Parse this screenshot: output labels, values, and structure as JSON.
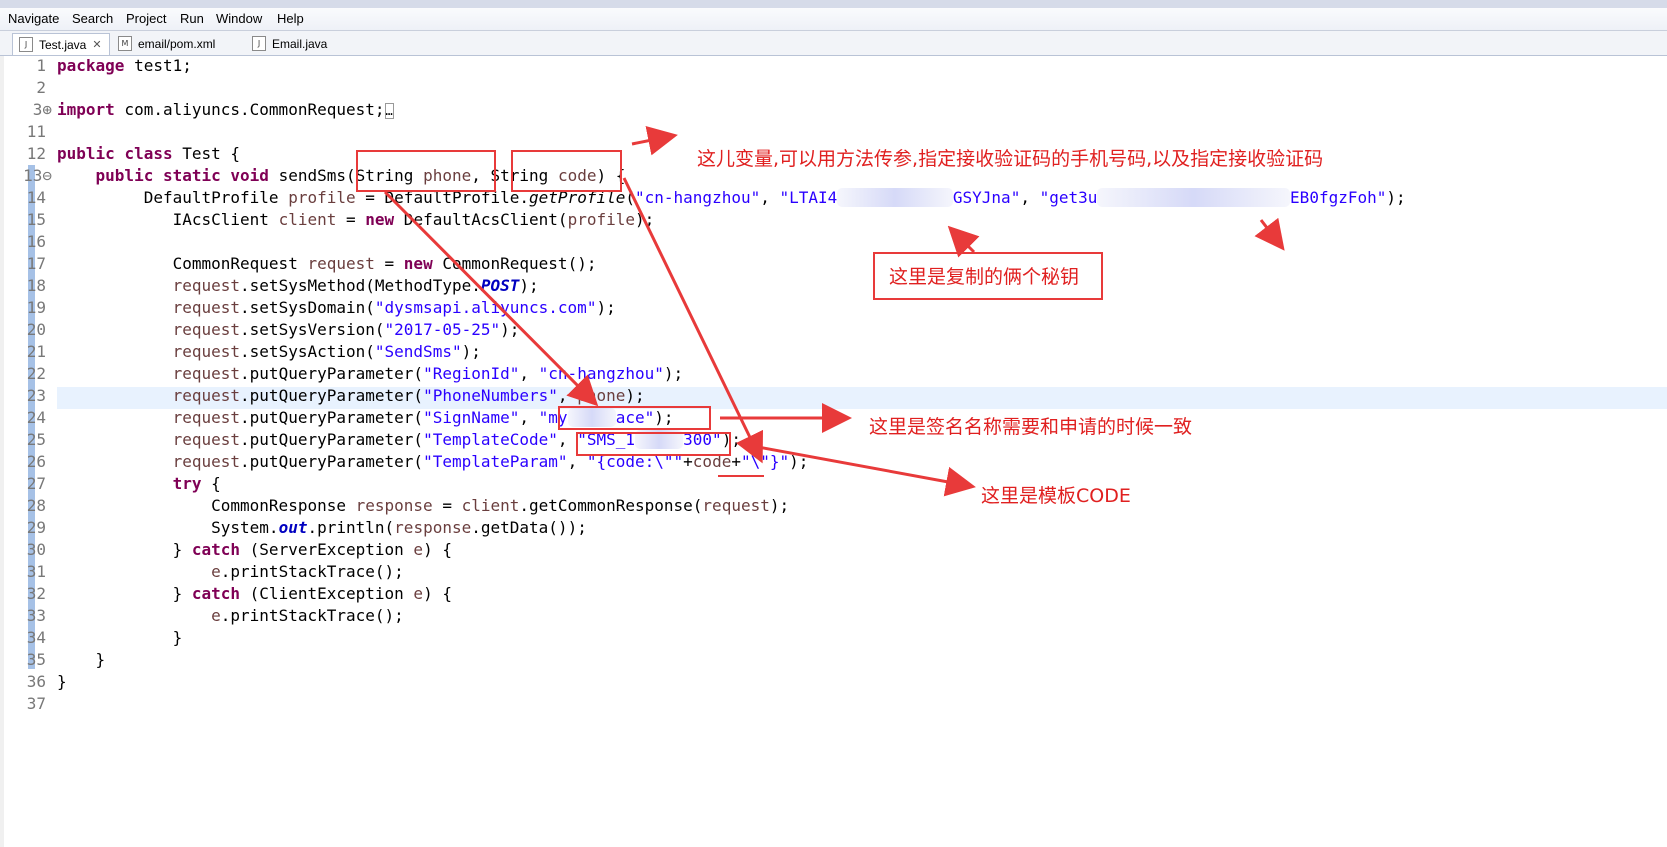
{
  "menu": [
    "Navigate",
    "Search",
    "Project",
    "Run",
    "Window",
    "Help"
  ],
  "tabs": [
    {
      "label": "Test.java",
      "badge": "J",
      "close": "✕"
    },
    {
      "label": "email/pom.xml",
      "badge": "M"
    },
    {
      "label": "Email.java",
      "badge": "J"
    }
  ],
  "line_numbers": [
    "1",
    "2",
    "3⊕",
    "11",
    "12",
    "13⊖",
    "14",
    "15",
    "16",
    "17",
    "18",
    "19",
    "20",
    "21",
    "22",
    "23",
    "24",
    "25",
    "26",
    "27",
    "28",
    "29",
    "30",
    "31",
    "32",
    "33",
    "34",
    "35",
    "36",
    "37"
  ],
  "code": {
    "l1_kw": "package",
    "l1_rest": " test1;",
    "l3_kw": "import",
    "l3_rest": " com.aliyuncs.CommonRequest;",
    "l3_fold": "…",
    "l12_kw1": "public",
    "l12_kw2": "class",
    "l12_rest": " Test {",
    "l13_kw1": "public",
    "l13_kw2": "static",
    "l13_kw3": "void",
    "l13_a": " sendSms(String ",
    "l13_p1": "phone",
    "l13_b": ", String ",
    "l13_p2": "code",
    "l13_c": ") {",
    "l14_a": "DefaultProfile ",
    "l14_var": "profile",
    "l14_b": " = DefaultProfile.",
    "l14_method": "getProfile",
    "l14_c": "(",
    "l14_s1": "\"cn-hangzhou\"",
    "l14_d": ", ",
    "l14_s2a": "\"LTAI4",
    "l14_s2b": "GSYJna\"",
    "l14_e": ", ",
    "l14_s3a": "\"get3u",
    "l14_s3b": "EB0fgzFoh\"",
    "l14_f": ");",
    "l15_a": "IAcsClient ",
    "l15_var": "client",
    "l15_b": " = ",
    "l15_kw": "new",
    "l15_c": " DefaultAcsClient(",
    "l15_var2": "profile",
    "l15_d": ");",
    "l17_a": "CommonRequest ",
    "l17_var": "request",
    "l17_b": " = ",
    "l17_kw": "new",
    "l17_c": " CommonRequest();",
    "l18_var": "request",
    "l18_a": ".setSysMethod(MethodType.",
    "l18_field": "POST",
    "l18_b": ");",
    "l19_var": "request",
    "l19_a": ".setSysDomain(",
    "l19_str": "\"dysmsapi.aliyuncs.com\"",
    "l19_b": ");",
    "l20_var": "request",
    "l20_a": ".setSysVersion(",
    "l20_str": "\"2017-05-25\"",
    "l20_b": ");",
    "l21_var": "request",
    "l21_a": ".setSysAction(",
    "l21_str": "\"SendSms\"",
    "l21_b": ");",
    "l22_var": "request",
    "l22_a": ".putQueryParameter(",
    "l22_s1": "\"RegionId\"",
    "l22_b": ", ",
    "l22_s2": "\"cn-hangzhou\"",
    "l22_c": ");",
    "l23_var": "request",
    "l23_a": ".putQueryParameter(",
    "l23_s1": "\"PhoneNumbers\"",
    "l23_b": ", ",
    "l23_var2": "phone",
    "l23_c": ");",
    "l24_var": "request",
    "l24_a": ".putQueryParameter(",
    "l24_s1": "\"SignName\"",
    "l24_b": ", ",
    "l24_s2a": "\"my",
    "l24_s2b": "ace\"",
    "l24_c": ");",
    "l25_var": "request",
    "l25_a": ".putQueryParameter(",
    "l25_s1": "\"TemplateCode\"",
    "l25_b": ", ",
    "l25_s2a": "\"SMS_1",
    "l25_s2b": "300\"",
    "l25_c": ");",
    "l26_var": "request",
    "l26_a": ".putQueryParameter(",
    "l26_s1": "\"TemplateParam\"",
    "l26_b": ", ",
    "l26_s2": "\"{code:\\\"\"",
    "l26_c": "+",
    "l26_var2": "code",
    "l26_d": "+",
    "l26_s3": "\"\\\"}\"",
    "l26_e": ");",
    "l27_kw": "try",
    "l27_rest": " {",
    "l28_a": "CommonResponse ",
    "l28_var": "response",
    "l28_b": " = ",
    "l28_var2": "client",
    "l28_c": ".getCommonResponse(",
    "l28_var3": "request",
    "l28_d": ");",
    "l29_a": "System.",
    "l29_field": "out",
    "l29_b": ".println(",
    "l29_var": "response",
    "l29_c": ".getData());",
    "l30_a": "} ",
    "l30_kw": "catch",
    "l30_b": " (ServerException ",
    "l30_var": "e",
    "l30_c": ") {",
    "l31_var": "e",
    "l31_a": ".printStackTrace();",
    "l32_a": "} ",
    "l32_kw": "catch",
    "l32_b": " (ClientException ",
    "l32_var": "e",
    "l32_c": ") {",
    "l33_var": "e",
    "l33_a": ".printStackTrace();",
    "l34": "}",
    "l35": "}",
    "l36": "}"
  },
  "annotations": {
    "note_params": "这儿变量,可以用方法传参,指定接收验证码的手机号码,以及指定接收验证码",
    "note_keys": "这里是复制的俩个秘钥",
    "note_sign": "这里是签名名称需要和申请的时候一致",
    "note_template": "这里是模板CODE"
  },
  "colors": {
    "keyword": "#7f0055",
    "string": "#2a00ff",
    "variable": "#6a3e3e",
    "field": "#0000c0",
    "annotation_red": "#e83a3a",
    "current_line": "#e8f2fe"
  }
}
